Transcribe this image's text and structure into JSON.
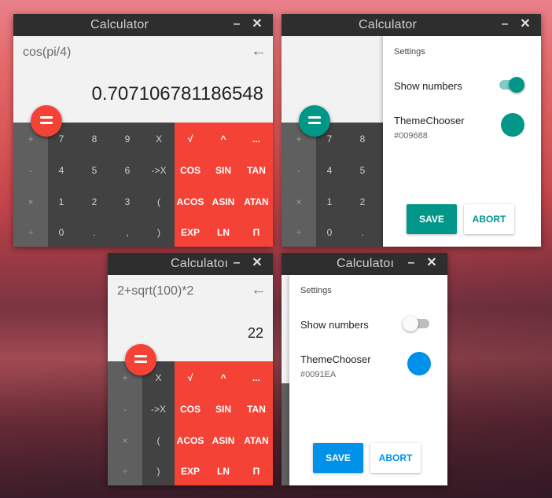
{
  "windows": [
    {
      "title": "Calculator",
      "minimize": "–",
      "close": "✕",
      "expression": "cos(pi/4)",
      "backspace": "←",
      "result": "0.707106781186548",
      "ops": [
        "+",
        "-",
        "×",
        "÷"
      ],
      "numbers": [
        [
          "7",
          "8",
          "9",
          "X"
        ],
        [
          "4",
          "5",
          "6",
          "->X"
        ],
        [
          "1",
          "2",
          "3",
          "("
        ],
        [
          "0",
          ".",
          ",",
          ")"
        ]
      ],
      "functions": [
        [
          "√",
          "^",
          "..."
        ],
        [
          "COS",
          "SIN",
          "TAN"
        ],
        [
          "ACOS",
          "ASIN",
          "ATAN"
        ],
        [
          "EXP",
          "LN",
          "Π"
        ]
      ],
      "accent": "#f44336"
    },
    {
      "title": "Calculator",
      "minimize": "–",
      "close": "✕",
      "ops": [
        "+",
        "-",
        "×",
        "÷"
      ],
      "numbers": [
        [
          "7",
          "8"
        ],
        [
          "4",
          "5"
        ],
        [
          "1",
          "2"
        ],
        [
          "0",
          "."
        ]
      ],
      "accent": "#009688",
      "settings": {
        "heading": "Settings",
        "show_numbers_label": "Show numbers",
        "show_numbers_on": true,
        "theme_label": "ThemeChooser",
        "theme_value": "#009688",
        "save": "SAVE",
        "abort": "ABORT"
      }
    },
    {
      "title": "Calculatoı",
      "minimize": "–",
      "close": "✕",
      "expression": "2+sqrt(100)*2",
      "backspace": "←",
      "result": "22",
      "ops": [
        "+",
        "-",
        "×",
        "÷"
      ],
      "numbers": [
        [
          "X"
        ],
        [
          "->X"
        ],
        [
          "("
        ],
        [
          ")"
        ]
      ],
      "functions": [
        [
          "√",
          "^",
          "..."
        ],
        [
          "COS",
          "SIN",
          "TAN"
        ],
        [
          "ACOS",
          "ASIN",
          "ATAN"
        ],
        [
          "EXP",
          "LN",
          "Π"
        ]
      ],
      "accent": "#f44336"
    },
    {
      "title": "Calculatoı",
      "minimize": "–",
      "close": "✕",
      "accent": "#0091EA",
      "settings": {
        "heading": "Settings",
        "show_numbers_label": "Show numbers",
        "show_numbers_on": false,
        "theme_label": "ThemeChooser",
        "theme_value": "#0091EA",
        "save": "SAVE",
        "abort": "ABORT"
      }
    }
  ]
}
